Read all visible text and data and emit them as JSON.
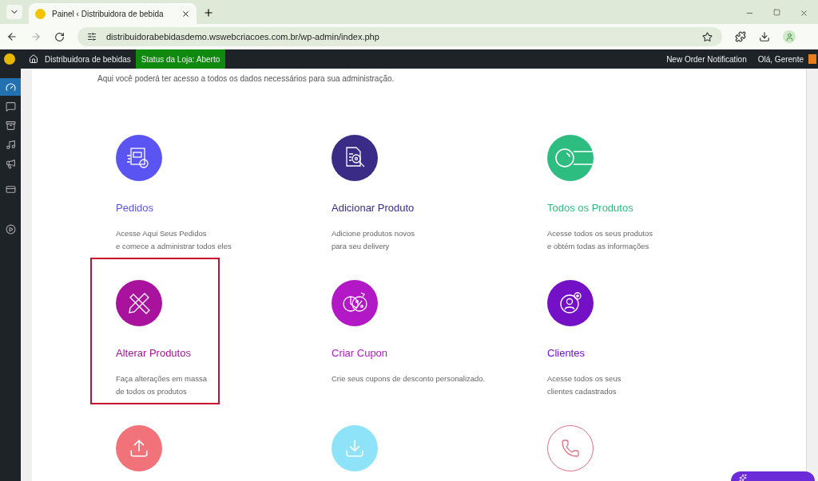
{
  "browser": {
    "tab_title": "Painel ‹ Distribuidora de bebida",
    "url": "distribuidorabebidasdemo.wswebcriacoes.com.br/wp-admin/index.php"
  },
  "admin_bar": {
    "site_name": "Distribuidora de bebidas",
    "store_status": "Status da Loja: Aberto",
    "notification": "New Order Notification",
    "greeting": "Olá, Gerente"
  },
  "sidebar": {
    "items": [
      {
        "selected": true
      },
      {
        "selected": false
      },
      {
        "selected": false
      },
      {
        "selected": false
      },
      {
        "selected": false
      },
      {
        "selected": false
      },
      {
        "selected": false
      }
    ]
  },
  "intro": "Aqui você poderá ter acesso a todos os dados necessários para sua administração.",
  "cards": [
    {
      "title": "Pedidos",
      "description": [
        "Acesse Aqui Seus Pedidos",
        "e comece a administrar todos eles"
      ],
      "color": "#5a55f2",
      "highlighted": false
    },
    {
      "title": "Adicionar Produto",
      "description": [
        "Adicione produtos novos",
        "para seu delivery"
      ],
      "color": "#3a2c86",
      "highlighted": false
    },
    {
      "title": "Todos os Produtos",
      "description": [
        "Acesse todos os seus produtos",
        "e obtém todas as informações"
      ],
      "color": "#2dbd80",
      "highlighted": false
    },
    {
      "title": "Alterar Produtos",
      "description": [
        "Faça alterações em massa",
        "de todos os produtos"
      ],
      "color": "#a8129c",
      "highlighted": true
    },
    {
      "title": "Criar Cupon",
      "description": [
        "Crie seus cupons de desconto personalizado."
      ],
      "color": "#b218c6",
      "highlighted": false
    },
    {
      "title": "Clientes",
      "description": [
        "Acesse todos os seus",
        "clientes cadastrados"
      ],
      "color": "#7410c6",
      "highlighted": false
    },
    {
      "color": "#f2727a",
      "highlighted": false
    },
    {
      "color": "#8fe3f8",
      "highlighted": false
    },
    {
      "color": "#e07080",
      "highlighted": false
    }
  ]
}
